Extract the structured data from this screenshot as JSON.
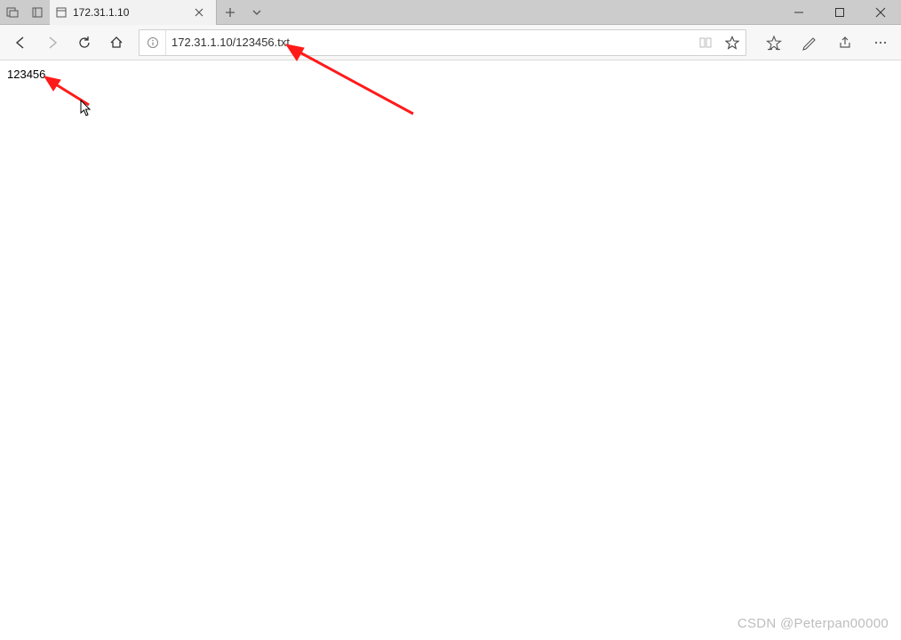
{
  "titlebar": {
    "tab_title": "172.31.1.10"
  },
  "toolbar": {
    "url": "172.31.1.10/123456.txt"
  },
  "content": {
    "body_text": "123456"
  },
  "watermark": "CSDN @Peterpan00000"
}
